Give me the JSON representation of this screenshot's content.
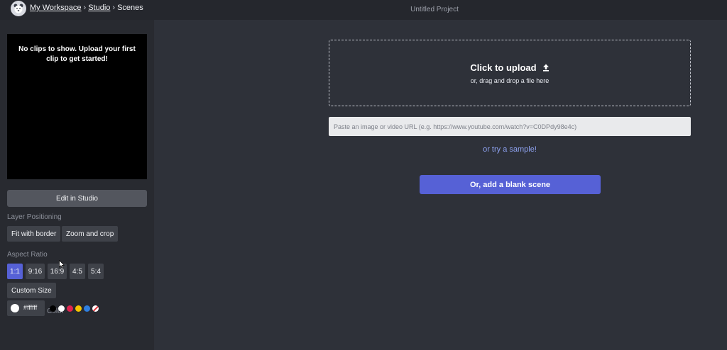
{
  "header": {
    "logo_icon": "bear-avatar-icon",
    "breadcrumb": [
      {
        "label": "My Workspace",
        "link": true
      },
      {
        "label": "Studio",
        "link": true
      },
      {
        "label": "Scenes",
        "link": false
      }
    ],
    "separator": "›",
    "project_title": "Untitled Project"
  },
  "sidebar": {
    "preview_message": "No clips to show. Upload your first clip to get started!",
    "edit_button": "Edit in Studio",
    "layer_positioning": {
      "label": "Layer Positioning",
      "options": [
        "Fit with border",
        "Zoom and crop"
      ]
    },
    "aspect_ratio": {
      "label": "Aspect Ratio",
      "options": [
        "1:1",
        "9:16",
        "16:9",
        "4:5",
        "5:4"
      ],
      "selected": "1:1",
      "custom_label": "Custom Size"
    },
    "background_color": {
      "label": "Background Color",
      "current_hex": "#ffffff",
      "swatches": [
        "#000000",
        "#ffffff",
        "#e0234e",
        "#f5c400",
        "#2f7fe0",
        "none"
      ]
    }
  },
  "main": {
    "upload_title": "Click to upload",
    "upload_icon": "upload-arrow-icon",
    "upload_subtitle": "or, drag and drop a file here",
    "url_placeholder": "Paste an image or video URL (e.g. https://www.youtube.com/watch?v=C0DPdy98e4c)",
    "sample_link": "or try a sample!",
    "blank_scene_button": "Or, add a blank scene"
  },
  "colors": {
    "accent": "#5661d6",
    "background": "#2e3139",
    "sidebar": "#282a30",
    "topbar": "#25272d"
  }
}
